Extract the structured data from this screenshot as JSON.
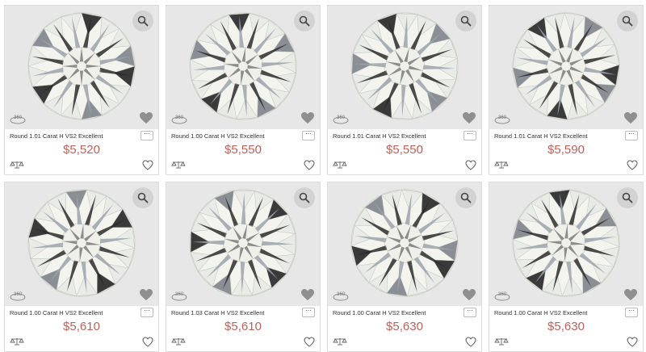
{
  "results": [
    {
      "title": "Round 1.01 Carat H VS2 Excellent",
      "price": "$5,520",
      "more": "⋯"
    },
    {
      "title": "Round 1.00 Carat H VS2 Excellent",
      "price": "$5,550",
      "more": "⋯"
    },
    {
      "title": "Round 1.01 Carat H VS2 Excellent",
      "price": "$5,550",
      "more": "⋯"
    },
    {
      "title": "Round 1.01 Carat H VS2 Excellent",
      "price": "$5,590",
      "more": "⋯"
    },
    {
      "title": "Round 1.00 Carat H VS2 Excellent",
      "price": "$5,610",
      "more": "⋯"
    },
    {
      "title": "Round 1.03 Carat H VS2 Excellent",
      "price": "$5,610",
      "more": "⋯"
    },
    {
      "title": "Round 1.00 Carat H VS2 Excellent",
      "price": "$5,630",
      "more": "⋯"
    },
    {
      "title": "Round 1.00 Carat H VS2 Excellent",
      "price": "$5,630",
      "more": "⋯"
    }
  ],
  "badge_360": "360",
  "icons": {
    "zoom": "magnifier-icon",
    "view360": "360-view-icon",
    "favorite_overlay": "heart-solid-icon",
    "compare": "compare-icon",
    "wishlist": "heart-outline-icon"
  },
  "colors": {
    "price": "#c0615c",
    "image_bg": "#e7e7e7",
    "border": "#dcdcdc"
  }
}
